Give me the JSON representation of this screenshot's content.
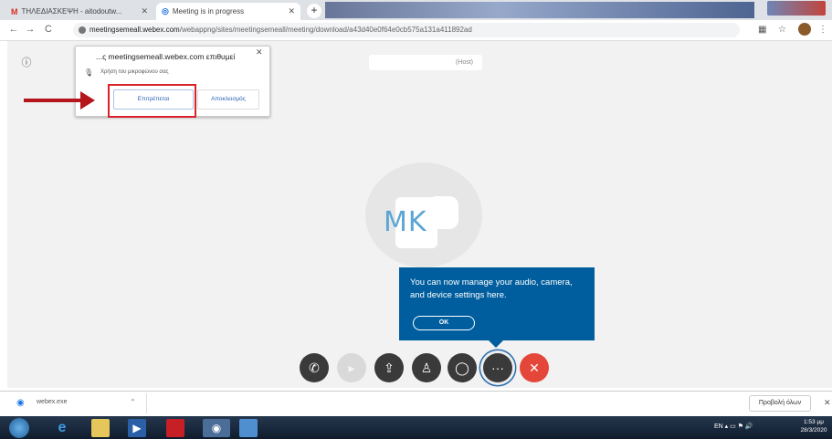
{
  "browser": {
    "tabs": [
      {
        "label": "ΤΗΛΕΔΙΑΣΚΕΨΗ - aitodoutw...",
        "icon": "gmail-icon",
        "active": false
      },
      {
        "label": "Meeting is in progress",
        "icon": "webex-icon",
        "active": true
      }
    ],
    "new_tab_label": "+",
    "url_host": "meetingsemeall.webex.com",
    "url_path": "/webappng/sites/meetingsemeall/meeting/download/a43d40e0f64e0cb575a131a411892ad"
  },
  "permission_popup": {
    "title": "...ς meetingsemeall.webex.com επιθυμεί",
    "description": "Χρήση του μικροφώνου σας",
    "allow_label": "Επιτρέπεται",
    "block_label": "Αποκλεισμός"
  },
  "meeting": {
    "host_label": "(Host)",
    "avatar_initials": "MK",
    "tooltip_text": "You can now manage your audio, camera, and device settings here.",
    "tooltip_ok": "OK",
    "controls": [
      "phone-icon",
      "video-icon",
      "share-icon",
      "participants-icon",
      "chat-icon",
      "more-icon",
      "leave-icon"
    ]
  },
  "download_shelf": {
    "file_name": "webex.exe",
    "show_all_label": "Προβολή όλων"
  },
  "taskbar": {
    "tray_language": "EN",
    "time": "1:53 μμ",
    "date": "28/3/2020"
  },
  "colors": {
    "tooltip": "#005e9e",
    "leave_button": "#e5463a",
    "highlight": "#d9232a"
  }
}
